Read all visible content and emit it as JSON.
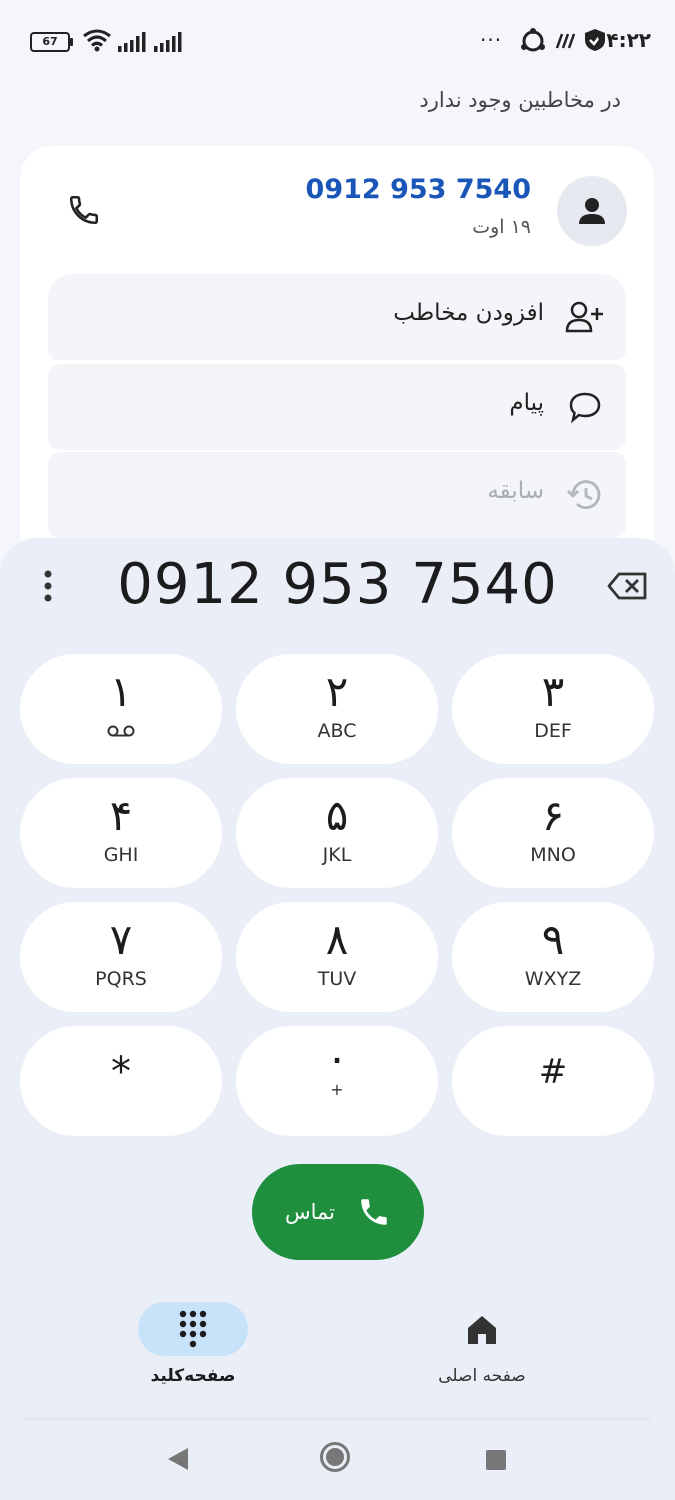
{
  "status_bar": {
    "battery": "67",
    "time": "۱۴:۲۲",
    "more": "···",
    "icons": [
      "wifi-icon",
      "signal-icon",
      "signal-icon",
      "app-notification-icon",
      "app-notification-icon",
      "shield-check-icon"
    ]
  },
  "header": {
    "not_in_contacts": "در مخاطبین وجود ندارد"
  },
  "contact": {
    "number": "0912 953 7540",
    "date": "۱۹ اوت",
    "avatar_icon": "person-icon",
    "call_icon": "phone-icon"
  },
  "actions": [
    {
      "label": "افزودن مخاطب",
      "icon": "add-person-icon",
      "enabled": true
    },
    {
      "label": "پیام",
      "icon": "message-icon",
      "enabled": true
    },
    {
      "label": "سابقه",
      "icon": "history-icon",
      "enabled": false
    }
  ],
  "dialer": {
    "number": "0912 953 7540",
    "keys": [
      {
        "digit": "۱",
        "letters": "ᴑᴑ"
      },
      {
        "digit": "۲",
        "letters": "ABC"
      },
      {
        "digit": "۳",
        "letters": "DEF"
      },
      {
        "digit": "۴",
        "letters": "GHI"
      },
      {
        "digit": "۵",
        "letters": "JKL"
      },
      {
        "digit": "۶",
        "letters": "MNO"
      },
      {
        "digit": "۷",
        "letters": "PQRS"
      },
      {
        "digit": "۸",
        "letters": "TUV"
      },
      {
        "digit": "۹",
        "letters": "WXYZ"
      },
      {
        "digit": "*",
        "letters": ""
      },
      {
        "digit": "۰",
        "letters": "+"
      },
      {
        "digit": "#",
        "letters": ""
      }
    ],
    "call_label": "تماس"
  },
  "nav": {
    "keypad_label": "صفحه‌کلید",
    "home_label": "صفحه اصلی"
  },
  "colors": {
    "accent_blue": "#1a56b8",
    "call_green": "#1f8f3e",
    "nav_active": "#c8e2fa"
  }
}
